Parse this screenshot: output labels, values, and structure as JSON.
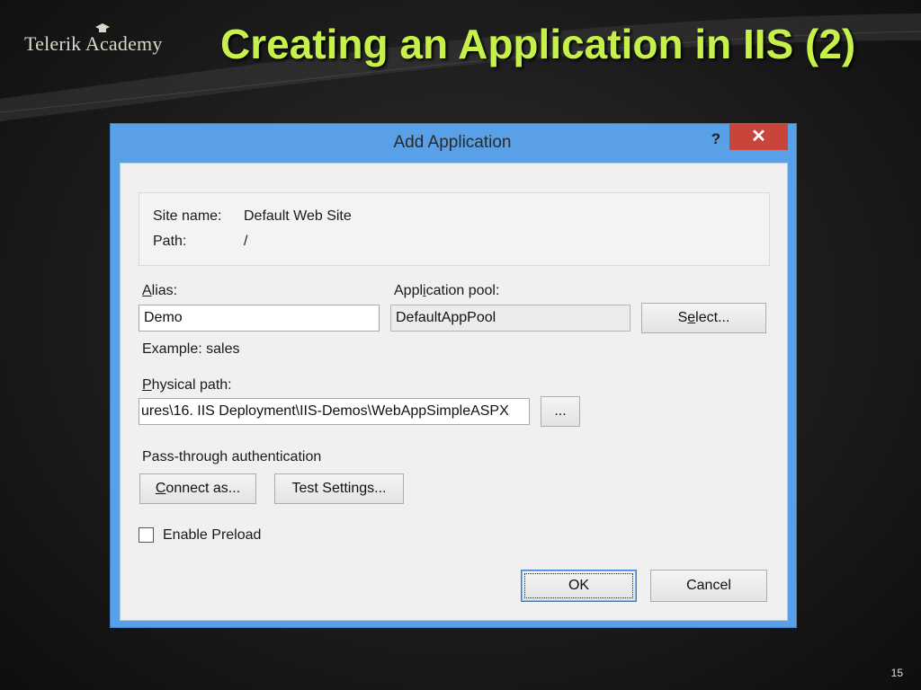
{
  "slide": {
    "logo": "Telerik Academy",
    "title": "Creating an Application in IIS (2)",
    "page_number": "15"
  },
  "dialog": {
    "title": "Add Application",
    "help_label": "?",
    "close_label": "✕",
    "site_name_label": "Site name:",
    "site_name_value": "Default Web Site",
    "path_label": "Path:",
    "path_value": "/",
    "alias_label_pre": "",
    "alias_label_u": "A",
    "alias_label_post": "lias:",
    "alias_value": "Demo",
    "app_pool_label_pre": "Appl",
    "app_pool_label_u": "i",
    "app_pool_label_post": "cation pool:",
    "app_pool_value": "DefaultAppPool",
    "select_label_pre": "S",
    "select_label_u": "e",
    "select_label_post": "lect...",
    "example_text": "Example: sales",
    "physical_path_label_u": "P",
    "physical_path_label_post": "hysical path:",
    "physical_path_value": "ures\\16. IIS Deployment\\IIS-Demos\\WebAppSimpleASPX",
    "browse_label": "...",
    "passthrough_label": "Pass-through authentication",
    "connect_as_u": "C",
    "connect_as_post": "onnect as...",
    "test_settings_pre": "Test Settin",
    "test_settings_u": "g",
    "test_settings_post": "s...",
    "enable_preload_label": "Enable Preload",
    "enable_preload_checked": false,
    "ok_label": "OK",
    "cancel_label": "Cancel"
  },
  "colors": {
    "title_green": "#c6f04a",
    "dialog_frame": "#5aa0e6",
    "close_red": "#c9443a"
  }
}
